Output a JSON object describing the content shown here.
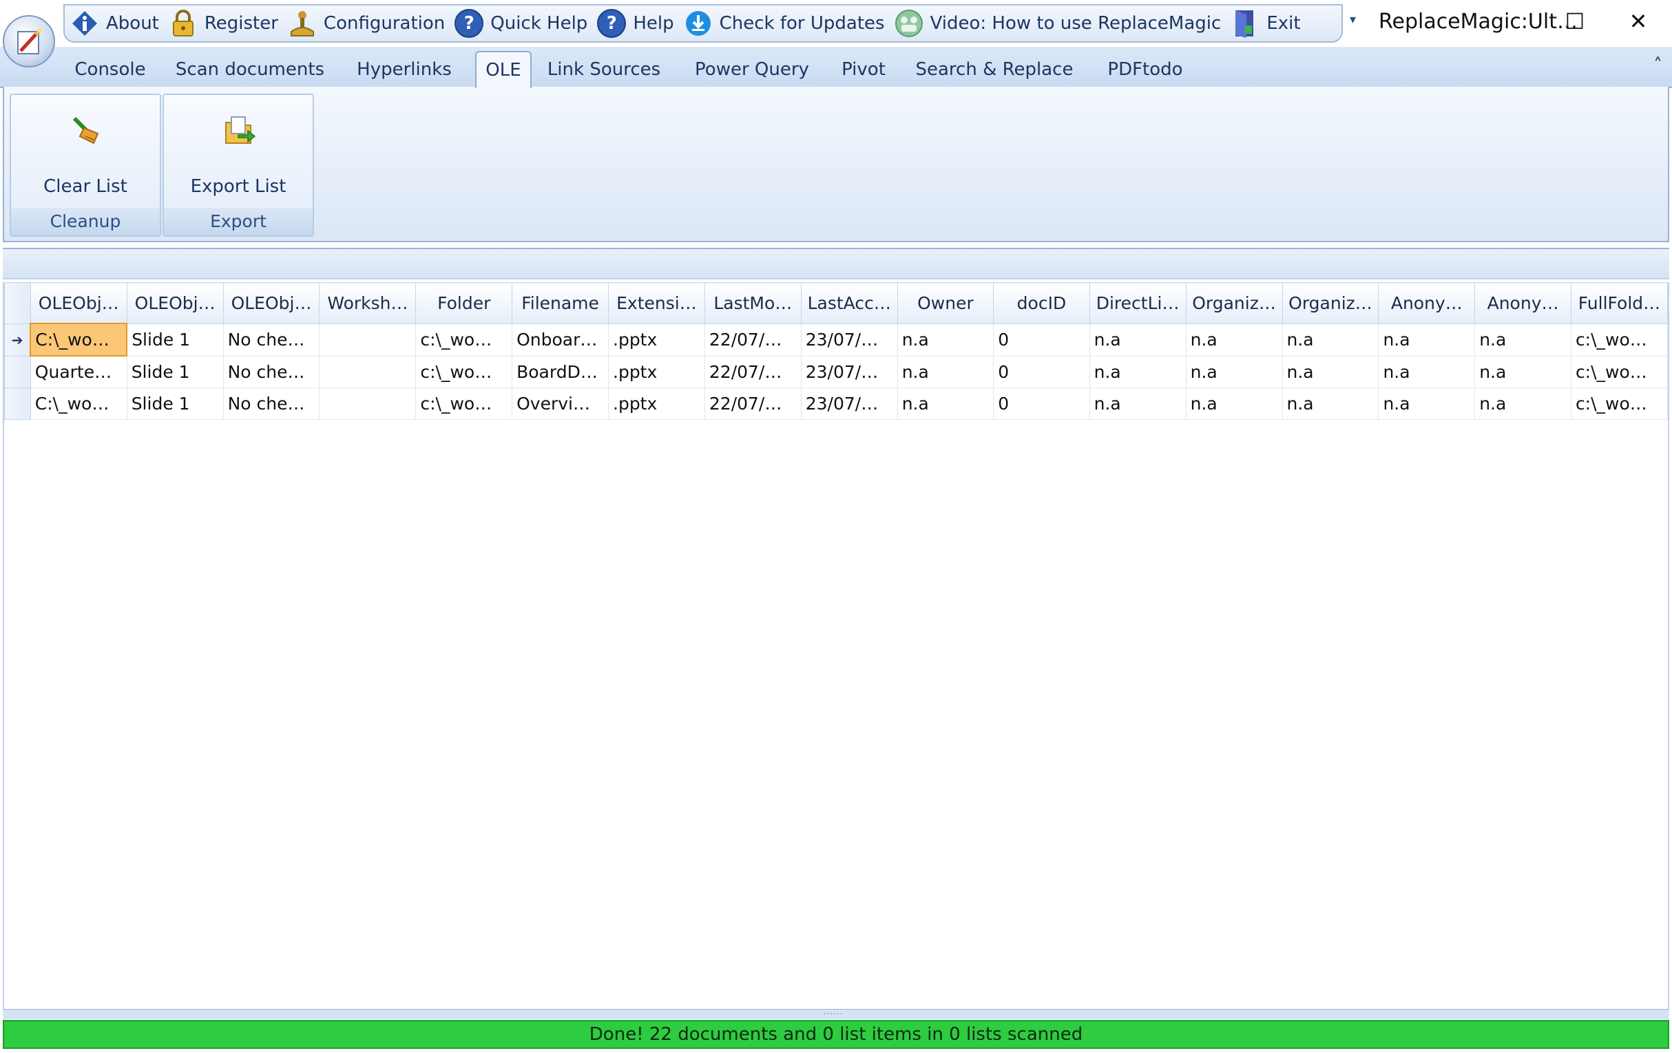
{
  "window": {
    "title": "ReplaceMagic:Ult…",
    "maximize_glyph": "☐",
    "close_glyph": "✕"
  },
  "quick_access": {
    "items": [
      {
        "label": "About",
        "icon": "info-icon"
      },
      {
        "label": "Register",
        "icon": "lock-icon"
      },
      {
        "label": "Configuration",
        "icon": "joystick-icon"
      },
      {
        "label": "Quick Help",
        "icon": "help-icon"
      },
      {
        "label": "Help",
        "icon": "help-icon"
      },
      {
        "label": "Check for Updates",
        "icon": "download-icon"
      },
      {
        "label": "Video: How to use ReplaceMagic",
        "icon": "video-icon"
      },
      {
        "label": "Exit",
        "icon": "exit-door-icon"
      }
    ],
    "dropdown_glyph": "▾"
  },
  "tabs": [
    {
      "label": "Console"
    },
    {
      "label": "Scan documents"
    },
    {
      "label": "Hyperlinks"
    },
    {
      "label": "OLE",
      "active": true
    },
    {
      "label": "Link Sources"
    },
    {
      "label": "Power Query"
    },
    {
      "label": "Pivot"
    },
    {
      "label": "Search & Replace"
    },
    {
      "label": "PDFtodo"
    }
  ],
  "ribbon": {
    "collapse_glyph": "˄",
    "groups": [
      {
        "name": "Cleanup",
        "button": "Clear List",
        "icon": "broom-icon"
      },
      {
        "name": "Export",
        "button": "Export List",
        "icon": "export-folder-icon"
      }
    ]
  },
  "grid": {
    "columns": [
      "OLEObj…",
      "OLEObj…",
      "OLEObj…",
      "Worksh…",
      "Folder",
      "Filename",
      "Extensi…",
      "LastMo…",
      "LastAcc…",
      "Owner",
      "docID",
      "DirectLi…",
      "Organiz…",
      "Organiz…",
      "Anony…",
      "Anony…",
      "FullFold…"
    ],
    "rows": [
      [
        "C:\\_wo…",
        "Slide 1",
        "No che…",
        "",
        "c:\\_wo…",
        "Onboar…",
        ".pptx",
        "22/07/…",
        "23/07/…",
        "n.a",
        "0",
        "n.a",
        "n.a",
        "n.a",
        "n.a",
        "n.a",
        "c:\\_wo…"
      ],
      [
        "Quarte…",
        "Slide 1",
        "No che…",
        "",
        "c:\\_wo…",
        "BoardD…",
        ".pptx",
        "22/07/…",
        "23/07/…",
        "n.a",
        "0",
        "n.a",
        "n.a",
        "n.a",
        "n.a",
        "n.a",
        "c:\\_wo…"
      ],
      [
        "C:\\_wo…",
        "Slide 1",
        "No che…",
        "",
        "c:\\_wo…",
        "Overvi…",
        ".pptx",
        "22/07/…",
        "23/07/…",
        "n.a",
        "0",
        "n.a",
        "n.a",
        "n.a",
        "n.a",
        "n.a",
        "c:\\_wo…"
      ]
    ],
    "current_row_glyph": "➔"
  },
  "status": {
    "text": "Done! 22 documents and 0 list items in 0 lists scanned",
    "color": "#2ecc40"
  }
}
